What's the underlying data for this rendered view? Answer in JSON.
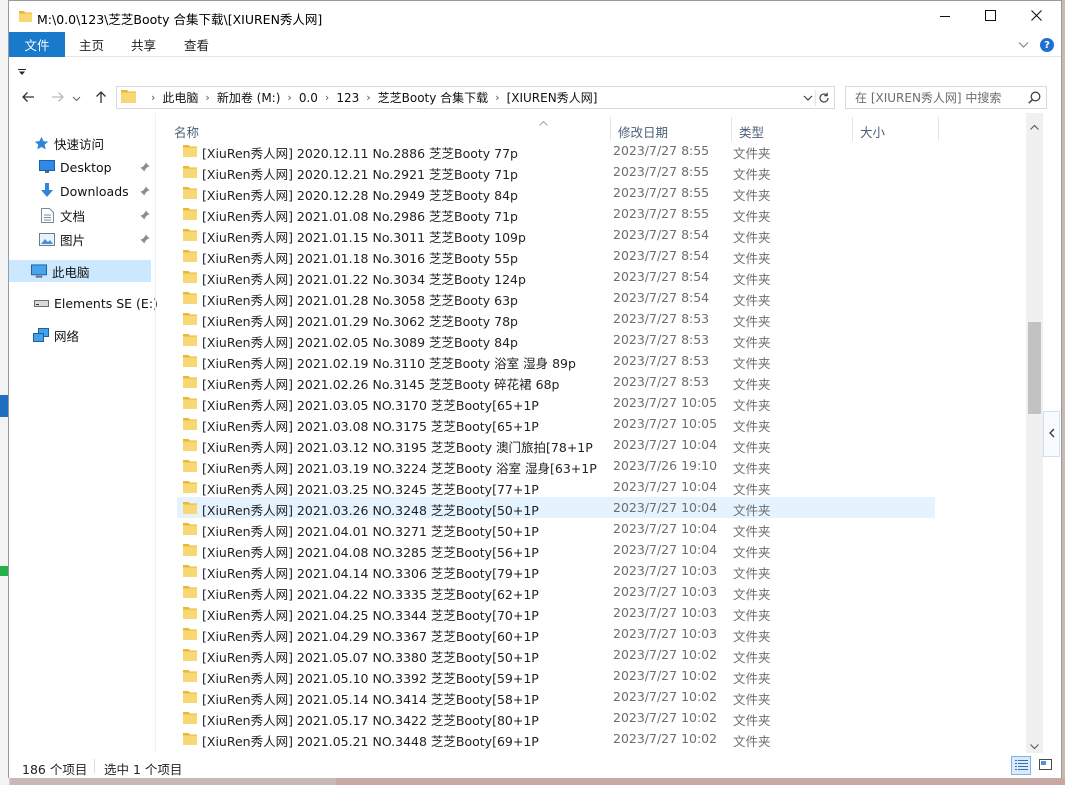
{
  "window": {
    "title": "M:\\0.0\\123\\芝芝Booty 合集下载\\[XIUREN秀人网]"
  },
  "ribbon": {
    "tabs": [
      "文件",
      "主页",
      "共享",
      "查看"
    ]
  },
  "address": {
    "crumbs": [
      "此电脑",
      "新加卷 (M:)",
      "0.0",
      "123",
      "芝芝Booty 合集下载",
      "[XIUREN秀人网]"
    ]
  },
  "search": {
    "placeholder": "在 [XIUREN秀人网] 中搜索"
  },
  "nav": {
    "items": [
      {
        "label": "快速访问",
        "icon": "star-icon"
      },
      {
        "label": "Desktop",
        "icon": "desktop-icon"
      },
      {
        "label": "Downloads",
        "icon": "download-arrow-icon"
      },
      {
        "label": "文档",
        "icon": "document-icon"
      },
      {
        "label": "图片",
        "icon": "picture-icon"
      },
      {
        "label": "此电脑",
        "icon": "computer-icon"
      },
      {
        "label": "Elements SE (E:)",
        "icon": "drive-icon"
      },
      {
        "label": "网络",
        "icon": "network-icon"
      }
    ]
  },
  "columns": {
    "name": "名称",
    "date": "修改日期",
    "type": "类型",
    "size": "大小"
  },
  "files": [
    {
      "name": "[XiuRen秀人网] 2020.12.11 No.2886 芝芝Booty 77p",
      "date": "2023/7/27 8:55",
      "type": "文件夹"
    },
    {
      "name": "[XiuRen秀人网] 2020.12.21 No.2921 芝芝Booty 71p",
      "date": "2023/7/27 8:55",
      "type": "文件夹"
    },
    {
      "name": "[XiuRen秀人网] 2020.12.28 No.2949 芝芝Booty 84p",
      "date": "2023/7/27 8:55",
      "type": "文件夹"
    },
    {
      "name": "[XiuRen秀人网] 2021.01.08 No.2986 芝芝Booty 71p",
      "date": "2023/7/27 8:55",
      "type": "文件夹"
    },
    {
      "name": "[XiuRen秀人网] 2021.01.15 No.3011 芝芝Booty 109p",
      "date": "2023/7/27 8:54",
      "type": "文件夹"
    },
    {
      "name": "[XiuRen秀人网] 2021.01.18 No.3016 芝芝Booty 55p",
      "date": "2023/7/27 8:54",
      "type": "文件夹"
    },
    {
      "name": "[XiuRen秀人网] 2021.01.22 No.3034 芝芝Booty 124p",
      "date": "2023/7/27 8:54",
      "type": "文件夹"
    },
    {
      "name": "[XiuRen秀人网] 2021.01.28 No.3058 芝芝Booty 63p",
      "date": "2023/7/27 8:54",
      "type": "文件夹"
    },
    {
      "name": "[XiuRen秀人网] 2021.01.29 No.3062 芝芝Booty 78p",
      "date": "2023/7/27 8:53",
      "type": "文件夹"
    },
    {
      "name": "[XiuRen秀人网] 2021.02.05 No.3089 芝芝Booty 84p",
      "date": "2023/7/27 8:53",
      "type": "文件夹"
    },
    {
      "name": "[XiuRen秀人网] 2021.02.19 No.3110 芝芝Booty 浴室 湿身 89p",
      "date": "2023/7/27 8:53",
      "type": "文件夹"
    },
    {
      "name": "[XiuRen秀人网] 2021.02.26 No.3145 芝芝Booty 碎花裙 68p",
      "date": "2023/7/27 8:53",
      "type": "文件夹"
    },
    {
      "name": "[XiuRen秀人网] 2021.03.05 NO.3170 芝芝Booty[65+1P",
      "date": "2023/7/27 10:05",
      "type": "文件夹"
    },
    {
      "name": "[XiuRen秀人网] 2021.03.08 NO.3175 芝芝Booty[65+1P",
      "date": "2023/7/27 10:05",
      "type": "文件夹"
    },
    {
      "name": "[XiuRen秀人网] 2021.03.12 NO.3195 芝芝Booty 澳门旅拍[78+1P",
      "date": "2023/7/27 10:04",
      "type": "文件夹"
    },
    {
      "name": "[XiuRen秀人网] 2021.03.19 NO.3224 芝芝Booty 浴室 湿身[63+1P",
      "date": "2023/7/26 19:10",
      "type": "文件夹"
    },
    {
      "name": "[XiuRen秀人网] 2021.03.25 NO.3245 芝芝Booty[77+1P",
      "date": "2023/7/27 10:04",
      "type": "文件夹"
    },
    {
      "name": "[XiuRen秀人网] 2021.03.26 NO.3248 芝芝Booty[50+1P",
      "date": "2023/7/27 10:04",
      "type": "文件夹",
      "selected": true
    },
    {
      "name": "[XiuRen秀人网] 2021.04.01 NO.3271 芝芝Booty[50+1P",
      "date": "2023/7/27 10:04",
      "type": "文件夹"
    },
    {
      "name": "[XiuRen秀人网] 2021.04.08 NO.3285 芝芝Booty[56+1P",
      "date": "2023/7/27 10:04",
      "type": "文件夹"
    },
    {
      "name": "[XiuRen秀人网] 2021.04.14 NO.3306 芝芝Booty[79+1P",
      "date": "2023/7/27 10:03",
      "type": "文件夹"
    },
    {
      "name": "[XiuRen秀人网] 2021.04.22 NO.3335 芝芝Booty[62+1P",
      "date": "2023/7/27 10:03",
      "type": "文件夹"
    },
    {
      "name": "[XiuRen秀人网] 2021.04.25 NO.3344 芝芝Booty[70+1P",
      "date": "2023/7/27 10:03",
      "type": "文件夹"
    },
    {
      "name": "[XiuRen秀人网] 2021.04.29 NO.3367 芝芝Booty[60+1P",
      "date": "2023/7/27 10:03",
      "type": "文件夹"
    },
    {
      "name": "[XiuRen秀人网] 2021.05.07 NO.3380 芝芝Booty[50+1P",
      "date": "2023/7/27 10:02",
      "type": "文件夹"
    },
    {
      "name": "[XiuRen秀人网] 2021.05.10 NO.3392 芝芝Booty[59+1P",
      "date": "2023/7/27 10:02",
      "type": "文件夹"
    },
    {
      "name": "[XiuRen秀人网] 2021.05.14 NO.3414 芝芝Booty[58+1P",
      "date": "2023/7/27 10:02",
      "type": "文件夹"
    },
    {
      "name": "[XiuRen秀人网] 2021.05.17 NO.3422 芝芝Booty[80+1P",
      "date": "2023/7/27 10:02",
      "type": "文件夹"
    },
    {
      "name": "[XiuRen秀人网] 2021.05.21 NO.3448 芝芝Booty[69+1P",
      "date": "2023/7/27 10:02",
      "type": "文件夹"
    }
  ],
  "status": {
    "count": "186 个项目",
    "selected": "选中 1 个项目"
  },
  "colors": {
    "accent": "#1979ca",
    "selection": "#e5f3ff",
    "folder": "#f8d775",
    "header_text": "#4c607a"
  }
}
